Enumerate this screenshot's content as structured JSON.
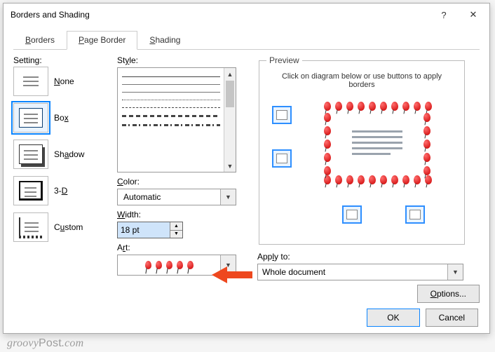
{
  "window": {
    "title": "Borders and Shading",
    "help": "?",
    "close": "✕"
  },
  "tabs": {
    "borders": "Borders",
    "page_border": "Page Border",
    "shading": "Shading",
    "active": "page_border",
    "borders_ul": "B",
    "page_border_ul": "P",
    "shading_ul": "S"
  },
  "setting": {
    "heading": "Setting:",
    "items": [
      {
        "label": "None",
        "ul": "N",
        "mode": "none"
      },
      {
        "label": "Box",
        "ul": "x",
        "mode": "box",
        "selected": true
      },
      {
        "label": "Shadow",
        "ul": "A",
        "mode": "shadow"
      },
      {
        "label": "3-D",
        "ul": "D",
        "mode": "threed",
        "prefix": "3-"
      },
      {
        "label": "Custom",
        "ul": "U",
        "mode": "custom",
        "prefix": "C",
        "suffix": "stom"
      }
    ]
  },
  "style": {
    "heading": "Style:",
    "color_heading": "Color:",
    "color_value": "Automatic",
    "width_heading": "Width:",
    "width_value": "18 pt",
    "art_heading": "Art:"
  },
  "preview": {
    "heading": "Preview",
    "hint": "Click on diagram below or use buttons to apply borders",
    "apply_heading": "Apply to:",
    "apply_value": "Whole document",
    "options": "Options..."
  },
  "footer": {
    "ok": "OK",
    "cancel": "Cancel"
  },
  "watermark": "groovyPost.com"
}
